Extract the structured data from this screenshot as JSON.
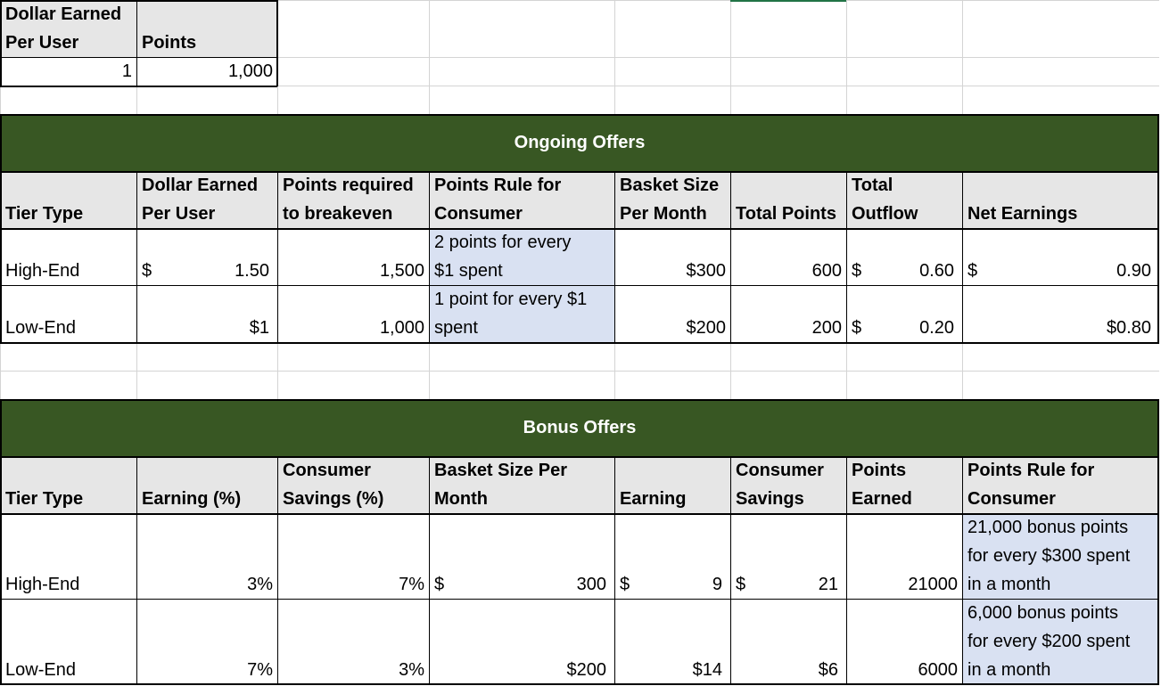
{
  "top": {
    "headers": [
      [
        "Dollar Earned",
        "Per User"
      ],
      [
        "Points"
      ]
    ],
    "values": [
      "1",
      "1,000"
    ]
  },
  "ongoing": {
    "title": "Ongoing Offers",
    "headers": [
      [
        "Tier Type"
      ],
      [
        "Dollar Earned",
        "Per User"
      ],
      [
        "Points required",
        "to breakeven"
      ],
      [
        "Points Rule for",
        "Consumer"
      ],
      [
        "Basket Size",
        "Per Month"
      ],
      [
        "Total Points"
      ],
      [
        "Total",
        "Outflow"
      ],
      [
        "Net Earnings"
      ]
    ],
    "rows": [
      {
        "tier": "High-End",
        "dollar_sym": "$",
        "dollar_val": "1.50",
        "breakeven": "1,500",
        "rule": [
          "2 points for every",
          "$1 spent"
        ],
        "basket": "$300",
        "total_points": "600",
        "outflow_sym": "$",
        "outflow_val": "0.60",
        "net_sym": "$",
        "net_val": "0.90"
      },
      {
        "tier": "Low-End",
        "dollar_sym": "",
        "dollar_val": "$1",
        "breakeven": "1,000",
        "rule": [
          "1 point for every $1",
          "spent"
        ],
        "basket": "$200",
        "total_points": "200",
        "outflow_sym": "$",
        "outflow_val": "0.20",
        "net_sym": "",
        "net_val": "$0.80"
      }
    ]
  },
  "bonus": {
    "title": "Bonus Offers",
    "headers": [
      [
        "Tier Type"
      ],
      [
        "Earning (%)"
      ],
      [
        "Consumer",
        "Savings (%)"
      ],
      [
        "Basket Size Per",
        "Month"
      ],
      [
        "Earning"
      ],
      [
        "Consumer",
        "Savings"
      ],
      [
        "Points",
        "Earned"
      ],
      [
        "Points Rule for",
        "Consumer"
      ]
    ],
    "rows": [
      {
        "tier": "High-End",
        "earning_pct": "3%",
        "savings_pct": "7%",
        "basket_sym": "$",
        "basket_val": "300",
        "earning_sym": "$",
        "earning_val": "9",
        "savings_sym": "$",
        "savings_val": "21",
        "points": "21000",
        "rule": [
          "21,000 bonus points",
          "for every $300 spent",
          "in a month"
        ]
      },
      {
        "tier": "Low-End",
        "earning_pct": "7%",
        "savings_pct": "3%",
        "basket_sym": "",
        "basket_val": "$200",
        "earning_sym": "",
        "earning_val": "$14",
        "savings_sym": "",
        "savings_val": "$6",
        "points": "6000",
        "rule": [
          "6,000 bonus points",
          "for every $200 spent",
          "in a month"
        ]
      }
    ]
  },
  "colors": {
    "banner": "#385723",
    "header_fill": "#e6e6e6",
    "rule_fill": "#d9e1f2",
    "selection": "#217346"
  }
}
